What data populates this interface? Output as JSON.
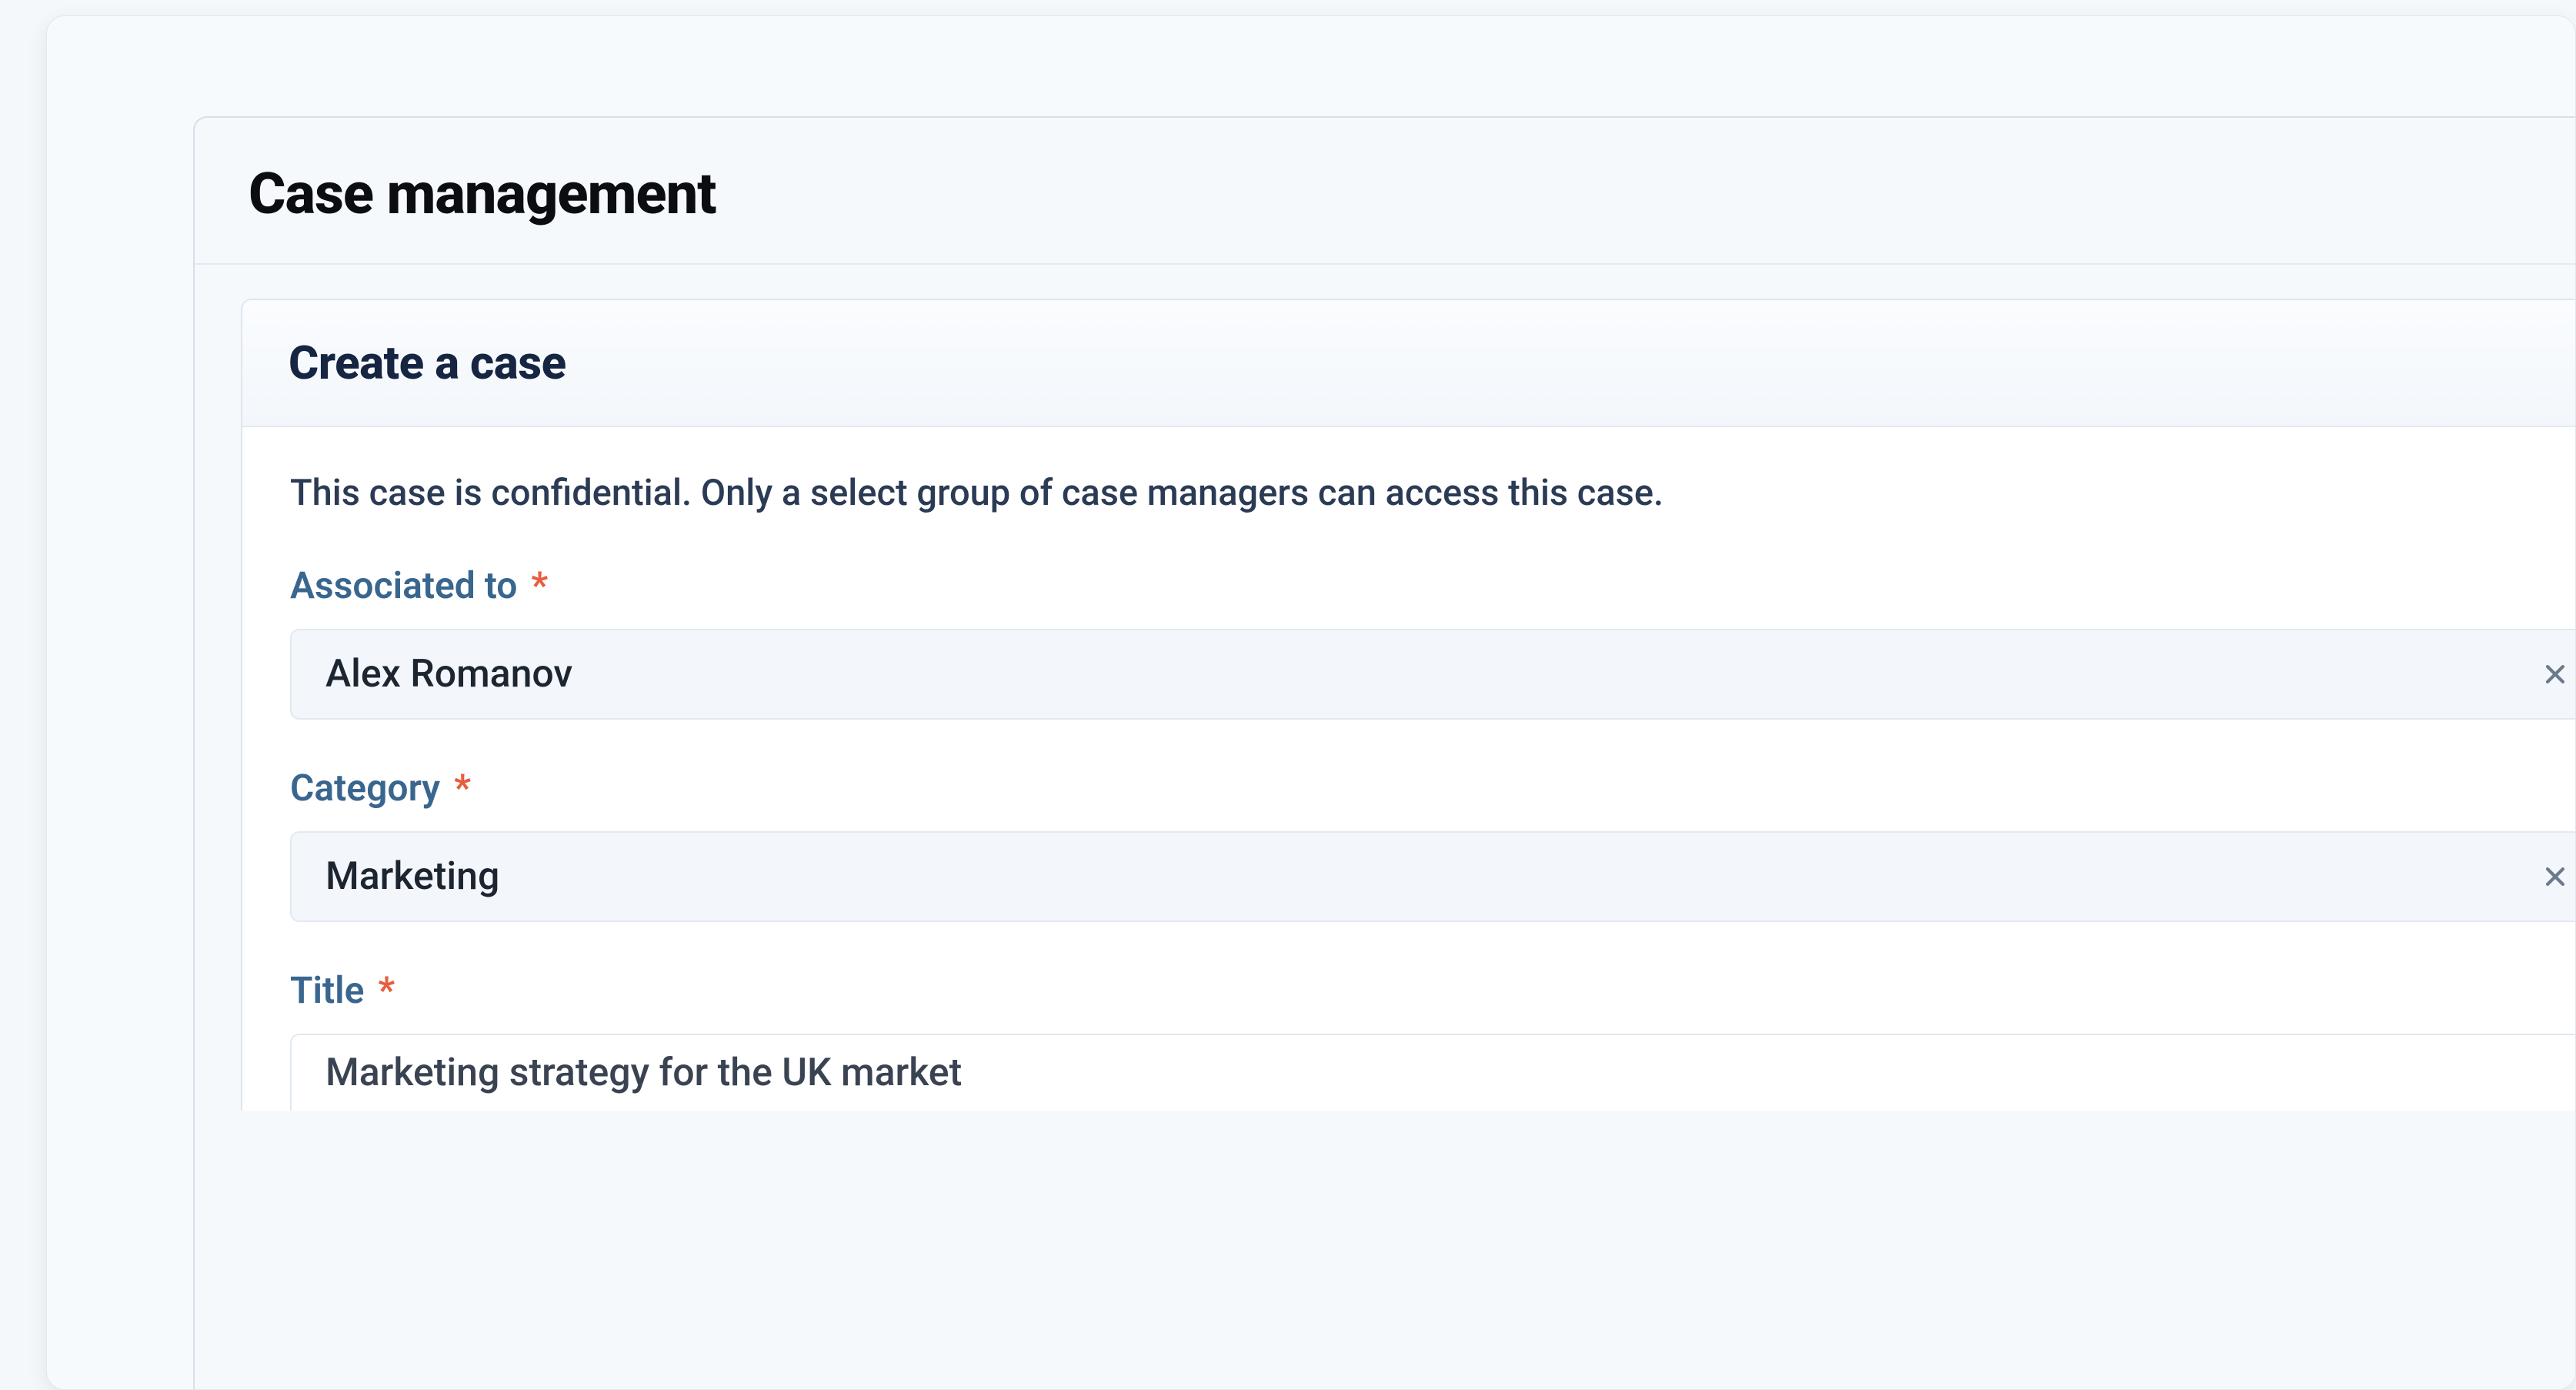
{
  "panel": {
    "title": "Case management"
  },
  "form": {
    "title": "Create a case",
    "info_text": "This case is confidential. Only a select group of case managers can access this case.",
    "fields": {
      "associated_to": {
        "label": "Associated to",
        "value": "Alex Romanov"
      },
      "category": {
        "label": "Category",
        "value": "Marketing"
      },
      "title": {
        "label": "Title",
        "value": "Marketing strategy for the UK market"
      }
    },
    "required_marker": "*"
  }
}
